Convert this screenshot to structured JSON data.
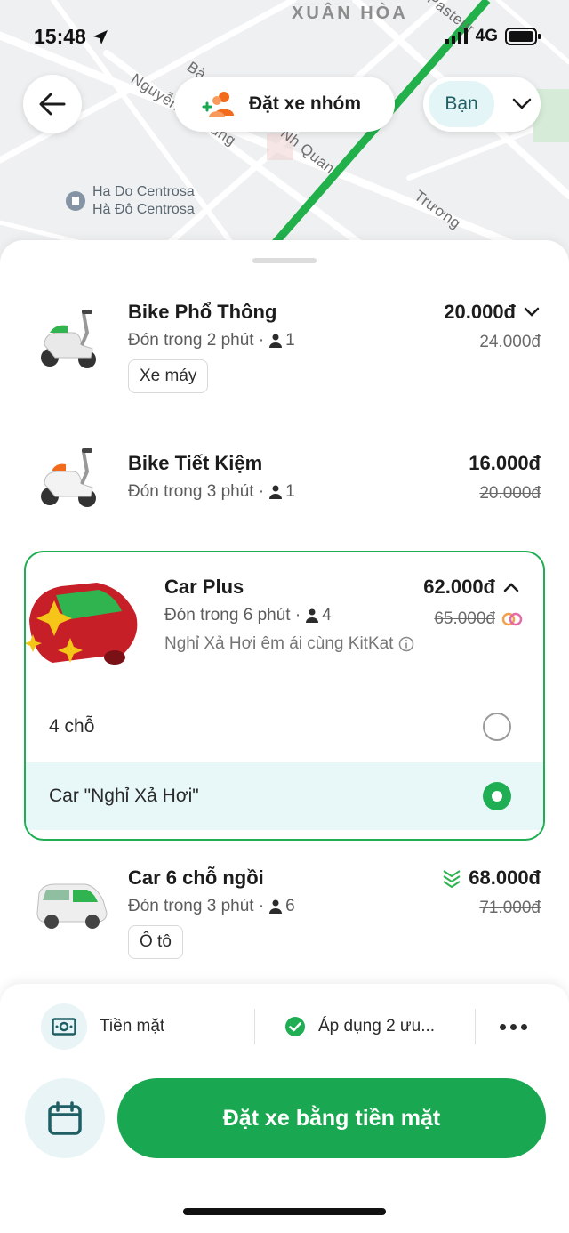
{
  "colors": {
    "brand": "#1aa751",
    "selected_border": "#1fae54",
    "selected_bg": "#e8f8f8"
  },
  "status_bar": {
    "time": "15:48",
    "network": "4G"
  },
  "map": {
    "district": "XUÂN HÒA",
    "street_1": "Nguyễn",
    "street_2": "Bà",
    "street_3": "Nh Quan",
    "street_4": "Trương",
    "street_5": "Pasteur",
    "street_6": "ung",
    "poi_line1": "Ha Do Centrosa",
    "poi_line2": "Hà Đô Centrosa"
  },
  "header": {
    "back_icon": "arrow-left-icon",
    "group_label": "Đặt xe nhóm",
    "profile_label": "Bạn"
  },
  "rides": [
    {
      "name": "Bike Phổ Thông",
      "eta": "Đón trong 2 phút ·",
      "seats": "1",
      "price": "20.000đ",
      "old_price": "24.000đ",
      "tag": "Xe máy"
    },
    {
      "name": "Bike Tiết Kiệm",
      "eta": "Đón trong 3 phút ·",
      "seats": "1",
      "price": "16.000đ",
      "old_price": "20.000đ"
    },
    {
      "name": "Car Plus",
      "eta": "Đón trong 6 phút ·",
      "seats": "4",
      "price": "62.000đ",
      "old_price": "65.000đ",
      "promo": "Nghỉ Xả Hơi êm ái cùng KitKat",
      "options": [
        {
          "label": "4 chỗ",
          "selected": false
        },
        {
          "label": "Car \"Nghỉ Xả Hơi\"",
          "selected": true
        }
      ]
    },
    {
      "name": "Car 6 chỗ ngồi",
      "eta": "Đón trong 3 phút ·",
      "seats": "6",
      "price": "68.000đ",
      "old_price": "71.000đ",
      "tag": "Ô tô"
    }
  ],
  "bottom": {
    "payment_label": "Tiền mặt",
    "promo_label": "Áp dụng 2 ưu...",
    "book_label": "Đặt xe bằng tiền mặt"
  }
}
